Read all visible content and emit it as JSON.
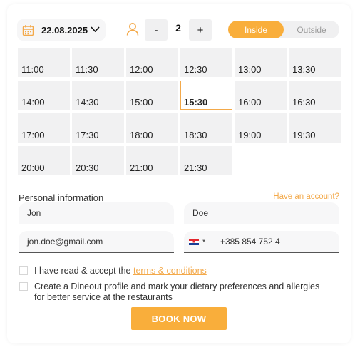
{
  "header": {
    "date": "22.08.2025",
    "guest_count": "2",
    "minus_label": "-",
    "plus_label": "+",
    "seating": {
      "inside": "Inside",
      "outside": "Outside",
      "selected": "Inside"
    }
  },
  "time_slots": [
    "11:00",
    "11:30",
    "12:00",
    "12:30",
    "13:00",
    "13:30",
    "14:00",
    "14:30",
    "15:00",
    "15:30",
    "16:30",
    "17:00",
    "17:30",
    "18:00",
    "18:30",
    "19:00",
    "19:30",
    "20:00",
    "20:30",
    "21:00",
    "21:30"
  ],
  "time_slot_grid": [
    "11:00",
    "11:30",
    "12:00",
    "12:30",
    "13:00",
    "13:30",
    "14:00",
    "14:30",
    "15:00",
    "15:30",
    "16:00",
    "16:30",
    "17:00",
    "17:30",
    "18:00",
    "18:30",
    "19:00",
    "19:30",
    "20:00",
    "20:30",
    "21:00",
    "21:30"
  ],
  "selected_slot": "15:30",
  "personal": {
    "title": "Personal information",
    "account_link": "Have an account?",
    "first_name": "Jon",
    "last_name": "Doe",
    "email": "jon.doe@gmail.com",
    "phone": "+385 854 752 4"
  },
  "consent": {
    "terms_prefix": "I have read & accept the ",
    "terms_link": "terms & conditions",
    "profile_line1": "Create a Dineout profile and mark your dietary preferences and allergies",
    "profile_line2": "for better service at the restaurants"
  },
  "book_button": "BOOK NOW",
  "colors": {
    "accent": "#f9ae3b",
    "link": "#f3a94a"
  }
}
